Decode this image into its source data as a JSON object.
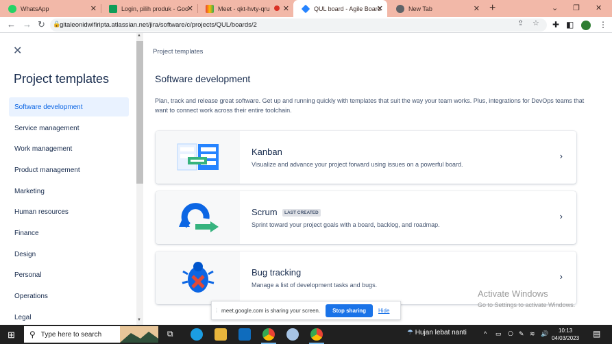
{
  "browser": {
    "tabs": [
      {
        "title": "WhatsApp",
        "icon": "whatsapp-icon",
        "color": "#25d366"
      },
      {
        "title": "Login, pilih produk - Goo",
        "icon": "sheets-icon",
        "color": "#0f9d58"
      },
      {
        "title": "Meet - qkt-hvty-qru",
        "icon": "meet-icon",
        "color": "#ea4335"
      },
      {
        "title": "QUL board - Agile Board",
        "icon": "jira-icon",
        "color": "#2684ff"
      },
      {
        "title": "New Tab",
        "icon": "chrome-icon",
        "color": "#5f6368"
      }
    ],
    "new_tab_glyph": "+",
    "url": "gitaleonidwifiripta.atlassian.net/jira/software/c/projects/QUL/boards/2"
  },
  "sidebar": {
    "title": "Project templates",
    "items": [
      {
        "label": "Software development",
        "selected": true
      },
      {
        "label": "Service management"
      },
      {
        "label": "Work management"
      },
      {
        "label": "Product management"
      },
      {
        "label": "Marketing"
      },
      {
        "label": "Human resources"
      },
      {
        "label": "Finance"
      },
      {
        "label": "Design"
      },
      {
        "label": "Personal"
      },
      {
        "label": "Operations"
      },
      {
        "label": "Legal"
      }
    ]
  },
  "main": {
    "breadcrumb": "Project templates",
    "title": "Software development",
    "description": "Plan, track and release great software. Get up and running quickly with templates that suit the way your team works. Plus, integrations for DevOps teams that want to connect work across their entire toolchain.",
    "templates": [
      {
        "name": "Kanban",
        "description": "Visualize and advance your project forward using issues on a powerful board.",
        "badge": ""
      },
      {
        "name": "Scrum",
        "description": "Sprint toward your project goals with a board, backlog, and roadmap.",
        "badge": "LAST CREATED"
      },
      {
        "name": "Bug tracking",
        "description": "Manage a list of development tasks and bugs.",
        "badge": ""
      }
    ]
  },
  "watermark": {
    "title": "Activate Windows",
    "subtitle": "Go to Settings to activate Windows."
  },
  "share_bar": {
    "message": "meet.google.com is sharing your screen.",
    "stop": "Stop sharing",
    "hide": "Hide"
  },
  "taskbar": {
    "search_placeholder": "Type here to search",
    "weather": "Hujan lebat nanti",
    "time": "10:13",
    "date": "04/03/2023"
  }
}
